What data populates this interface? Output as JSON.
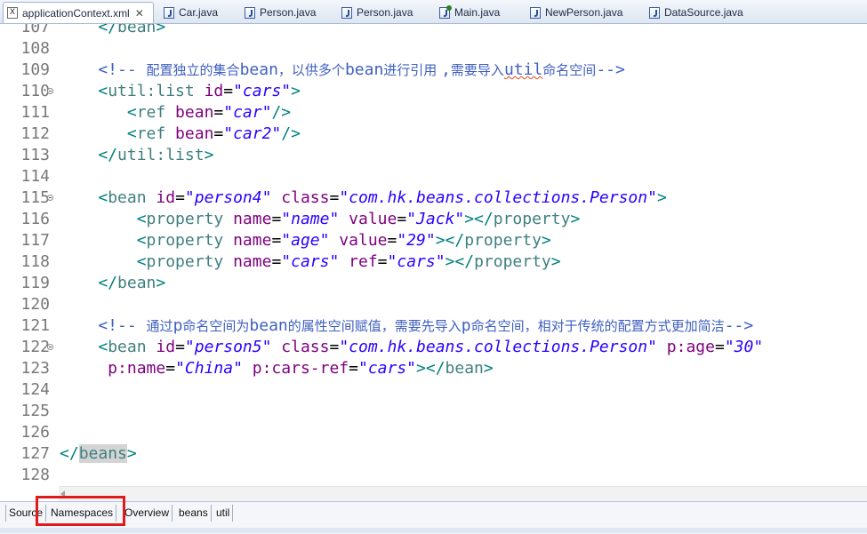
{
  "tabs": [
    {
      "label": "applicationContext.xml",
      "icon": "xml-file-icon",
      "active": true,
      "closable": true
    },
    {
      "label": "Car.java",
      "icon": "java-file-icon"
    },
    {
      "label": "Person.java",
      "icon": "java-file-icon"
    },
    {
      "label": "Person.java",
      "icon": "java-file-icon"
    },
    {
      "label": "Main.java",
      "icon": "java-main-file-icon"
    },
    {
      "label": "NewPerson.java",
      "icon": "java-file-icon"
    },
    {
      "label": "DataSource.java",
      "icon": "java-file-icon"
    }
  ],
  "editor": {
    "lines": [
      {
        "num": "107",
        "tokens": [
          [
            "br",
            "    </"
          ],
          [
            "tag",
            "bean"
          ],
          [
            "br",
            ">"
          ]
        ]
      },
      {
        "num": "108",
        "tokens": []
      },
      {
        "num": "109",
        "tokens": [
          [
            "cm",
            "    <!-- "
          ],
          [
            "cmcn",
            "配置独立的集合"
          ],
          [
            "cm",
            "bean"
          ],
          [
            "cmcn",
            "，以供多个"
          ],
          [
            "cm",
            "bean"
          ],
          [
            "cmcn",
            "进行引用 "
          ],
          [
            "cm",
            ","
          ],
          [
            "cmcn",
            "需要导入"
          ],
          [
            "cmsq",
            "util"
          ],
          [
            "cmcn",
            "命名空间"
          ],
          [
            "cm",
            "-->"
          ]
        ]
      },
      {
        "num": "110",
        "fold": true,
        "tokens": [
          [
            "br",
            "    <"
          ],
          [
            "tag",
            "util:list"
          ],
          [
            "attr",
            " id"
          ],
          [
            "eq",
            "="
          ],
          [
            "val",
            "\"cars\""
          ],
          [
            "br",
            ">"
          ]
        ]
      },
      {
        "num": "111",
        "tokens": [
          [
            "br",
            "       <"
          ],
          [
            "tag",
            "ref"
          ],
          [
            "attr",
            " bean"
          ],
          [
            "eq",
            "="
          ],
          [
            "val",
            "\"car\""
          ],
          [
            "br",
            "/>"
          ]
        ]
      },
      {
        "num": "112",
        "tokens": [
          [
            "br",
            "       <"
          ],
          [
            "tag",
            "ref"
          ],
          [
            "attr",
            " bean"
          ],
          [
            "eq",
            "="
          ],
          [
            "val",
            "\"car2\""
          ],
          [
            "br",
            "/>"
          ]
        ]
      },
      {
        "num": "113",
        "tokens": [
          [
            "br",
            "    </"
          ],
          [
            "tag",
            "util:list"
          ],
          [
            "br",
            ">"
          ]
        ]
      },
      {
        "num": "114",
        "tokens": []
      },
      {
        "num": "115",
        "fold": true,
        "tokens": [
          [
            "br",
            "    <"
          ],
          [
            "tag",
            "bean"
          ],
          [
            "attr",
            " id"
          ],
          [
            "eq",
            "="
          ],
          [
            "val",
            "\"person4\""
          ],
          [
            "attr",
            " class"
          ],
          [
            "eq",
            "="
          ],
          [
            "val",
            "\"com.hk.beans.collections.Person\""
          ],
          [
            "br",
            ">"
          ]
        ]
      },
      {
        "num": "116",
        "tokens": [
          [
            "br",
            "        <"
          ],
          [
            "tag",
            "property"
          ],
          [
            "attr",
            " name"
          ],
          [
            "eq",
            "="
          ],
          [
            "val",
            "\"name\""
          ],
          [
            "attr",
            " value"
          ],
          [
            "eq",
            "="
          ],
          [
            "val",
            "\"Jack\""
          ],
          [
            "br",
            "></"
          ],
          [
            "tag",
            "property"
          ],
          [
            "br",
            ">"
          ]
        ]
      },
      {
        "num": "117",
        "tokens": [
          [
            "br",
            "        <"
          ],
          [
            "tag",
            "property"
          ],
          [
            "attr",
            " name"
          ],
          [
            "eq",
            "="
          ],
          [
            "val",
            "\"age\""
          ],
          [
            "attr",
            " value"
          ],
          [
            "eq",
            "="
          ],
          [
            "val",
            "\"29\""
          ],
          [
            "br",
            "></"
          ],
          [
            "tag",
            "property"
          ],
          [
            "br",
            ">"
          ]
        ]
      },
      {
        "num": "118",
        "tokens": [
          [
            "br",
            "        <"
          ],
          [
            "tag",
            "property"
          ],
          [
            "attr",
            " name"
          ],
          [
            "eq",
            "="
          ],
          [
            "val",
            "\"cars\""
          ],
          [
            "attr",
            " ref"
          ],
          [
            "eq",
            "="
          ],
          [
            "val",
            "\"cars\""
          ],
          [
            "br",
            "></"
          ],
          [
            "tag",
            "property"
          ],
          [
            "br",
            ">"
          ]
        ]
      },
      {
        "num": "119",
        "tokens": [
          [
            "br",
            "    </"
          ],
          [
            "tag",
            "bean"
          ],
          [
            "br",
            ">"
          ]
        ]
      },
      {
        "num": "120",
        "tokens": []
      },
      {
        "num": "121",
        "tokens": [
          [
            "cm",
            "    <!-- "
          ],
          [
            "cmcn",
            "通过"
          ],
          [
            "cm",
            "p"
          ],
          [
            "cmcn",
            "命名空间为"
          ],
          [
            "cm",
            "bean"
          ],
          [
            "cmcn",
            "的属性空间赋值，需要先导入"
          ],
          [
            "cm",
            "p"
          ],
          [
            "cmcn",
            "命名空间，相对于传统的配置方式更加简洁"
          ],
          [
            "cm",
            "-->"
          ]
        ]
      },
      {
        "num": "122",
        "fold": true,
        "tokens": [
          [
            "br",
            "    <"
          ],
          [
            "tag",
            "bean"
          ],
          [
            "attr",
            " id"
          ],
          [
            "eq",
            "="
          ],
          [
            "val",
            "\"person5\""
          ],
          [
            "attr",
            " class"
          ],
          [
            "eq",
            "="
          ],
          [
            "val",
            "\"com.hk.beans.collections.Person\""
          ],
          [
            "attr",
            " p:age"
          ],
          [
            "eq",
            "="
          ],
          [
            "val",
            "\"30\""
          ]
        ]
      },
      {
        "num": "123",
        "tokens": [
          [
            "attr",
            "     p:name"
          ],
          [
            "eq",
            "="
          ],
          [
            "val",
            "\"China\""
          ],
          [
            "attr",
            " p:cars-ref"
          ],
          [
            "eq",
            "="
          ],
          [
            "val",
            "\"cars\""
          ],
          [
            "br",
            "></"
          ],
          [
            "tag",
            "bean"
          ],
          [
            "br",
            ">"
          ]
        ]
      },
      {
        "num": "124",
        "tokens": []
      },
      {
        "num": "125",
        "tokens": []
      },
      {
        "num": "126",
        "tokens": []
      },
      {
        "num": "127",
        "tokens": [
          [
            "br",
            "</"
          ],
          [
            "taghl",
            "beans"
          ],
          [
            "br",
            ">"
          ]
        ]
      },
      {
        "num": "128",
        "tokens": []
      }
    ]
  },
  "bottom_tabs": [
    "Source",
    "Namespaces",
    "Overview",
    "beans",
    "util"
  ],
  "highlighted_bottom_tab": "Namespaces",
  "colors": {
    "tag": "#3f7f7f",
    "attribute": "#7f007f",
    "value": "#2a00ff",
    "comment": "#3f5fbf",
    "highlight_box": "#e01b1b"
  }
}
